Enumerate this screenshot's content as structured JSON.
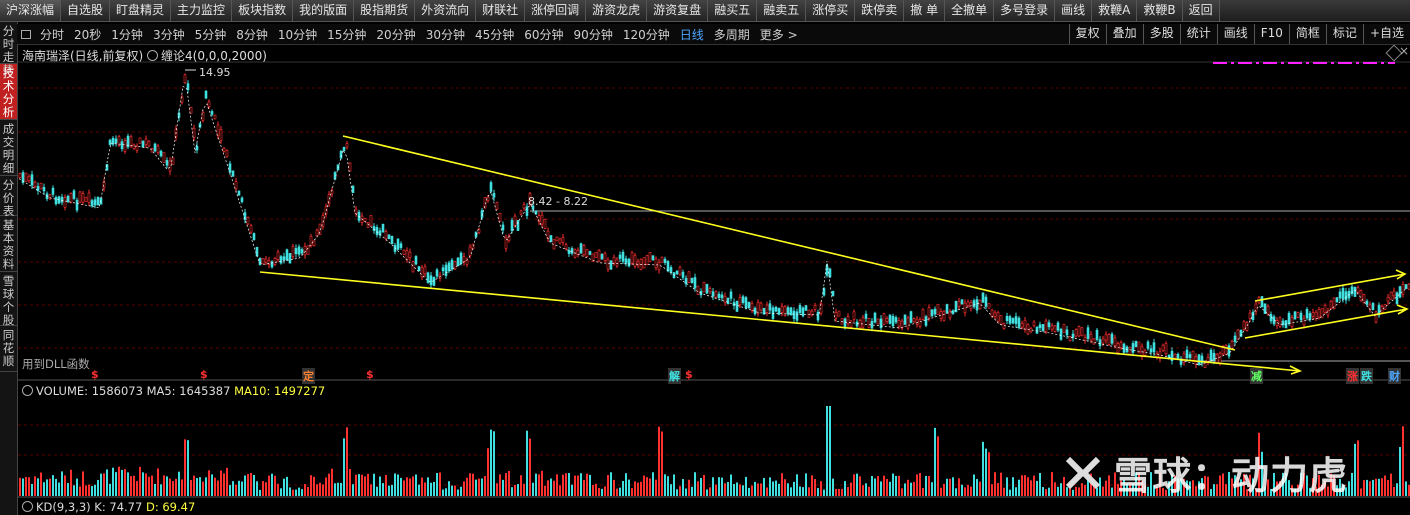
{
  "top_menu": [
    "沪深涨幅",
    "自选股",
    "盯盘精灵",
    "主力监控",
    "板块指数",
    "我的版面",
    "股指期货",
    "外资流向",
    "财联社",
    "涨停回调",
    "游资龙虎",
    "游资复盘",
    "融买五",
    "融卖五",
    "涨停买",
    "跌停卖",
    "撤 单",
    "全撤单",
    "多号登录",
    "画线",
    "救鞭A",
    "救鞭B",
    "返回"
  ],
  "periods": [
    "分时",
    "20秒",
    "1分钟",
    "3分钟",
    "5分钟",
    "8分钟",
    "10分钟",
    "15分钟",
    "20分钟",
    "30分钟",
    "45分钟",
    "60分钟",
    "90分钟",
    "120分钟",
    "日线",
    "多周期",
    "更多 >"
  ],
  "active_period": "日线",
  "right_tools": [
    "复权",
    "叠加",
    "多股",
    "统计",
    "画线",
    "F10",
    "简框",
    "标记",
    "+自选"
  ],
  "sidebar": [
    "分时走势",
    "技术分析",
    "成交明细",
    "分价表",
    "基本资料",
    "雪球个股",
    "同花顺"
  ],
  "active_sidebar": "技术分析",
  "chart_title": "海南瑞泽(日线,前复权)",
  "indicator": "缠论4(0,0,0,2000)",
  "high_label": "14.95",
  "range_label": "8.42 - 8.22",
  "dll_note": "用到DLL函数",
  "markers": [
    "$",
    "$",
    "定",
    "$",
    "解",
    "$",
    "减",
    "涨",
    "跌",
    "财"
  ],
  "volume": {
    "label": "VOLUME:",
    "value": "1586073",
    "ma5_label": "MA5:",
    "ma5": "1645387",
    "ma10_label": "MA10:",
    "ma10": "1497277"
  },
  "kd": {
    "label": "KD(9,3,3)",
    "k_label": "K:",
    "k": "74.77",
    "d_label": "D:",
    "d": "69.47"
  },
  "watermark": "雪球：动力虎",
  "colors": {
    "up": "#ff3030",
    "down": "#40e0e0",
    "trend": "#ffff20",
    "ma": "#ffffff",
    "active": "#c02020",
    "link": "#4da6ff"
  }
}
